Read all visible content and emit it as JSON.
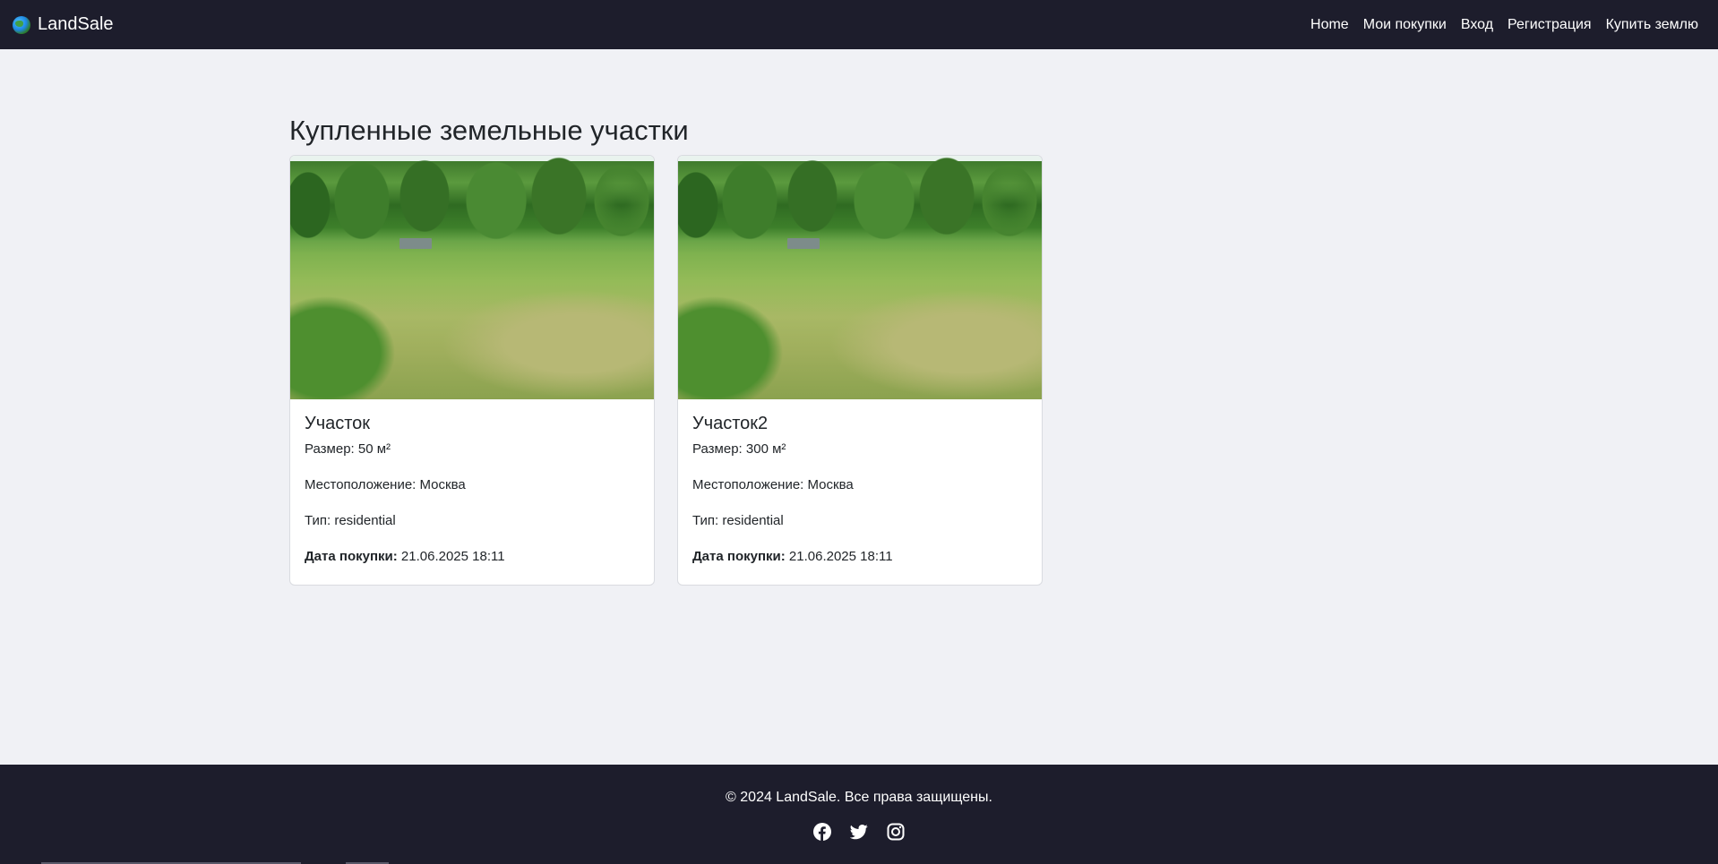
{
  "navbar": {
    "brand": "LandSale",
    "links": [
      "Home",
      "Мои покупки",
      "Вход",
      "Регистрация",
      "Купить землю"
    ]
  },
  "main": {
    "title": "Купленные земельные участки",
    "cards": [
      {
        "title": "Участок",
        "size": "Размер: 50 м²",
        "location": "Местоположение: Москва",
        "type": "Тип: residential",
        "date_label": "Дата покупки:",
        "date_value": " 21.06.2025 18:11"
      },
      {
        "title": "Участок2",
        "size": "Размер: 300 м²",
        "location": "Местоположение: Москва",
        "type": "Тип: residential",
        "date_label": "Дата покупки:",
        "date_value": " 21.06.2025 18:11"
      }
    ]
  },
  "footer": {
    "text": "© 2024 LandSale. Все права защищены.",
    "social_icons": [
      "facebook-icon",
      "twitter-icon",
      "instagram-icon"
    ]
  },
  "colors": {
    "navbar_bg": "#1d1d2c",
    "page_bg": "#f0f1f5",
    "card_bg": "#ffffff"
  }
}
